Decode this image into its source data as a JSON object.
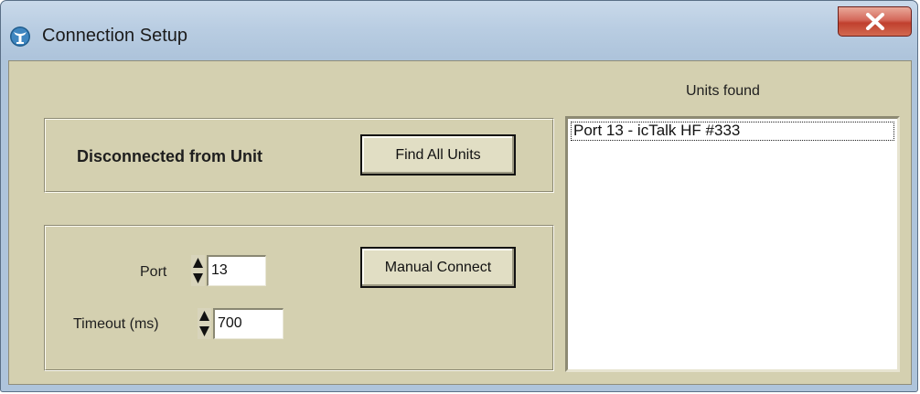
{
  "window": {
    "title": "Connection Setup",
    "icon": "antenna-app-icon",
    "close_icon": "close-icon"
  },
  "connection": {
    "status": "Disconnected from Unit",
    "find_button": "Find All Units"
  },
  "manual": {
    "port_label": "Port",
    "port_value": "13",
    "timeout_label": "Timeout (ms)",
    "timeout_value": "700",
    "connect_button": "Manual Connect"
  },
  "units": {
    "title": "Units found",
    "items": [
      "Port 13 - icTalk HF #333"
    ]
  },
  "colors": {
    "panel": "#d4d0b0",
    "titlebar": "#b9cde2",
    "close_button": "#c0402e"
  }
}
